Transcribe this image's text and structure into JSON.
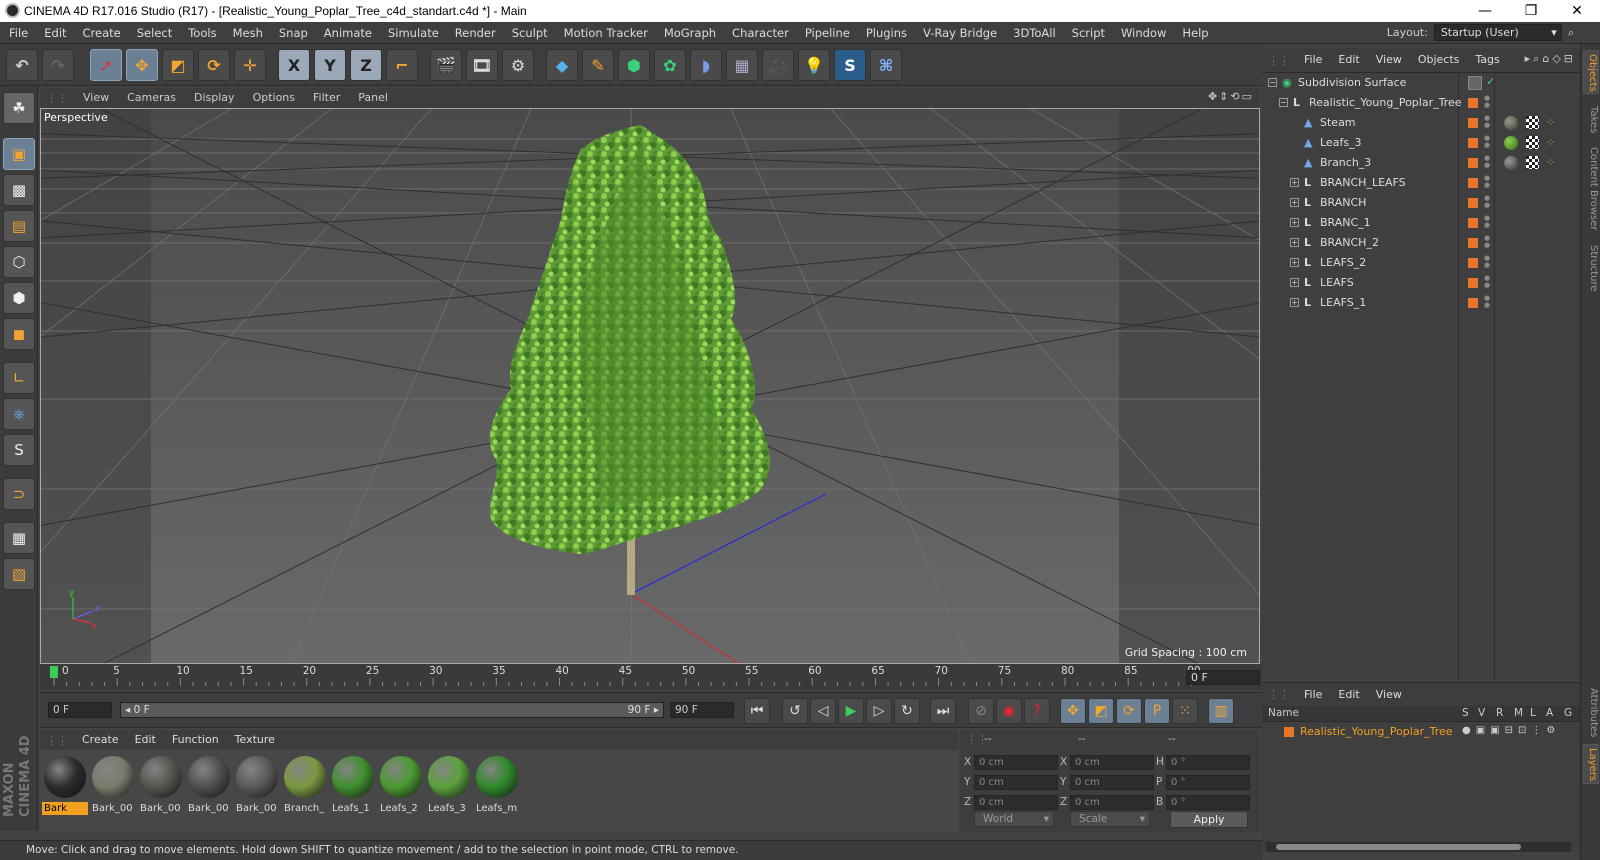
{
  "window": {
    "title": "CINEMA 4D R17.016 Studio (R17) - [Realistic_Young_Poplar_Tree_c4d_standart.c4d *] - Main",
    "minimize": "—",
    "restore": "❐",
    "close": "✕"
  },
  "menu": [
    "File",
    "Edit",
    "Create",
    "Select",
    "Tools",
    "Mesh",
    "Snap",
    "Animate",
    "Simulate",
    "Render",
    "Sculpt",
    "Motion Tracker",
    "MoGraph",
    "Character",
    "Pipeline",
    "Plugins",
    "V-Ray Bridge",
    "3DToAll",
    "Script",
    "Window",
    "Help"
  ],
  "layout": {
    "label": "Layout:",
    "value": "Startup (User)"
  },
  "toolbar": {
    "x_label": "X",
    "y_label": "Y",
    "z_label": "Z"
  },
  "viewport": {
    "menu": [
      "View",
      "Cameras",
      "Display",
      "Options",
      "Filter",
      "Panel"
    ],
    "label": "Perspective",
    "grid_spacing": "Grid Spacing : 100 cm",
    "axis_y": "y",
    "axis_z": "z",
    "axis_x": "x"
  },
  "timeline": {
    "ticks": [
      "0",
      "5",
      "10",
      "15",
      "20",
      "25",
      "30",
      "35",
      "40",
      "45",
      "50",
      "55",
      "60",
      "65",
      "70",
      "75",
      "80",
      "85",
      "90"
    ],
    "end_field": "0 F",
    "current_frame": "0 F",
    "range_start": "◂ 0 F",
    "range_end": "90 F ▸",
    "max_frame": "90 F"
  },
  "materials": {
    "menu": [
      "Create",
      "Edit",
      "Function",
      "Texture"
    ],
    "items": [
      {
        "label": "Bark",
        "color": "#2b2b2b",
        "selected": true
      },
      {
        "label": "Bark_00",
        "color": "#7a7a6c"
      },
      {
        "label": "Bark_00",
        "color": "#555550"
      },
      {
        "label": "Bark_00",
        "color": "#4f4f4c"
      },
      {
        "label": "Bark_00",
        "color": "#5a5a57"
      },
      {
        "label": "Branch_",
        "color": "#7b9840"
      },
      {
        "label": "Leafs_1",
        "color": "#3f8f2e"
      },
      {
        "label": "Leafs_2",
        "color": "#4a9a30"
      },
      {
        "label": "Leafs_3",
        "color": "#5aa23c"
      },
      {
        "label": "Leafs_m",
        "color": "#2f8a2a"
      }
    ]
  },
  "coords": {
    "head": [
      "--",
      "--",
      "--"
    ],
    "labels": [
      "X",
      "Y",
      "Z",
      "X",
      "Y",
      "Z",
      "H",
      "P",
      "B"
    ],
    "values": [
      "0 cm",
      "0 cm",
      "0 cm",
      "0 cm",
      "0 cm",
      "0 cm",
      "0 °",
      "0 °",
      "0 °"
    ],
    "world": "World",
    "scale": "Scale",
    "apply": "Apply"
  },
  "status": "Move: Click and drag to move elements. Hold down SHIFT to quantize movement / add to the selection in point mode, CTRL to remove.",
  "objects": {
    "menu": [
      "File",
      "Edit",
      "View",
      "Objects",
      "Tags"
    ],
    "rows": [
      {
        "name": "Subdivision Surface",
        "indent": 0,
        "icon": "subdivision-icon"
      },
      {
        "name": "Realistic_Young_Poplar_Tree",
        "indent": 1,
        "icon": "null-icon"
      },
      {
        "name": "Steam",
        "indent": 2,
        "icon": "polygon-icon"
      },
      {
        "name": "Leafs_3",
        "indent": 2,
        "icon": "polygon-icon"
      },
      {
        "name": "Branch_3",
        "indent": 2,
        "icon": "polygon-icon"
      },
      {
        "name": "BRANCH_LEAFS",
        "indent": 2,
        "icon": "null-icon"
      },
      {
        "name": "BRANCH",
        "indent": 2,
        "icon": "null-icon"
      },
      {
        "name": "BRANC_1",
        "indent": 2,
        "icon": "null-icon"
      },
      {
        "name": "BRANCH_2",
        "indent": 2,
        "icon": "null-icon"
      },
      {
        "name": "LEAFS_2",
        "indent": 2,
        "icon": "null-icon"
      },
      {
        "name": "LEAFS",
        "indent": 2,
        "icon": "null-icon"
      },
      {
        "name": "LEAFS_1",
        "indent": 2,
        "icon": "null-icon"
      }
    ]
  },
  "layers": {
    "menu": [
      "File",
      "Edit",
      "View"
    ],
    "headers": [
      "Name",
      "S",
      "V",
      "R",
      "M",
      "L",
      "A",
      "G"
    ],
    "row": "Realistic_Young_Poplar_Tree",
    "row_color": "#e8762a"
  },
  "sidetabs": [
    "Objects",
    "Takes",
    "Content Browser",
    "Structure",
    "Attributes",
    "Layers"
  ],
  "brand": "MAXON CINEMA 4D",
  "colors": {
    "accent": "#f1a020",
    "selection": "#6b7f95",
    "layer_orange": "#e8762a"
  }
}
